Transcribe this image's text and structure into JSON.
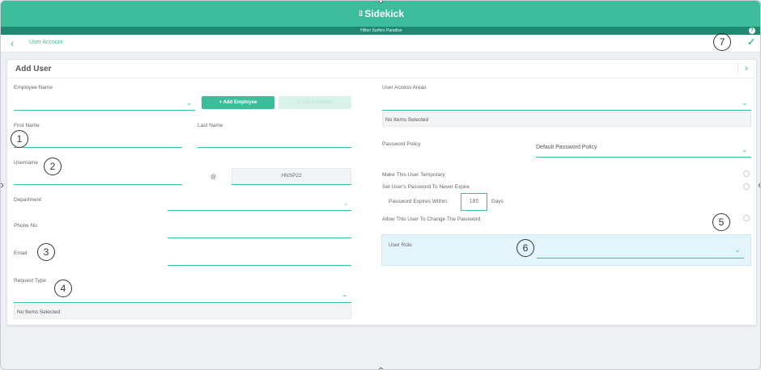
{
  "app": {
    "brand": "Sidekick",
    "site": "Hilton Surfers Paradise",
    "help_icon": "?"
  },
  "nav": {
    "breadcrumb": "User Account"
  },
  "panel": {
    "title": "Add User"
  },
  "left": {
    "employee_name_label": "Employee Name",
    "add_employee_label": "+ Add Employee",
    "edit_employee_label": "✎ Edit Employee",
    "first_name_label": "First Name",
    "last_name_label": "Last Name",
    "username_label": "Username",
    "at_symbol": "@",
    "domain_value": "HNSP22",
    "department_label": "Department",
    "phone_label": "Phone No",
    "email_label": "Email",
    "request_type_label": "Request Type",
    "request_type_selected": "No Items Selected"
  },
  "right": {
    "access_areas_label": "User Access Areas",
    "access_areas_selected": "No Items Selected",
    "password_policy_label": "Password Policy",
    "password_policy_value": "Default Password Policy",
    "temporary_label": "Make This User Temporary",
    "never_expire_label": "Set User's Password To Never Expire",
    "expires_within_label": "Password Expires Within:",
    "expires_within_value": "180",
    "expires_unit": "Days",
    "allow_change_label": "Allow This User To Change The Password",
    "user_role_label": "User Role"
  },
  "annotations": [
    "1",
    "2",
    "3",
    "4",
    "5",
    "6",
    "7"
  ],
  "colors": {
    "accent": "#3dbd9c",
    "accent_dark": "#1e8a71",
    "role_panel": "#e3f4fb"
  }
}
